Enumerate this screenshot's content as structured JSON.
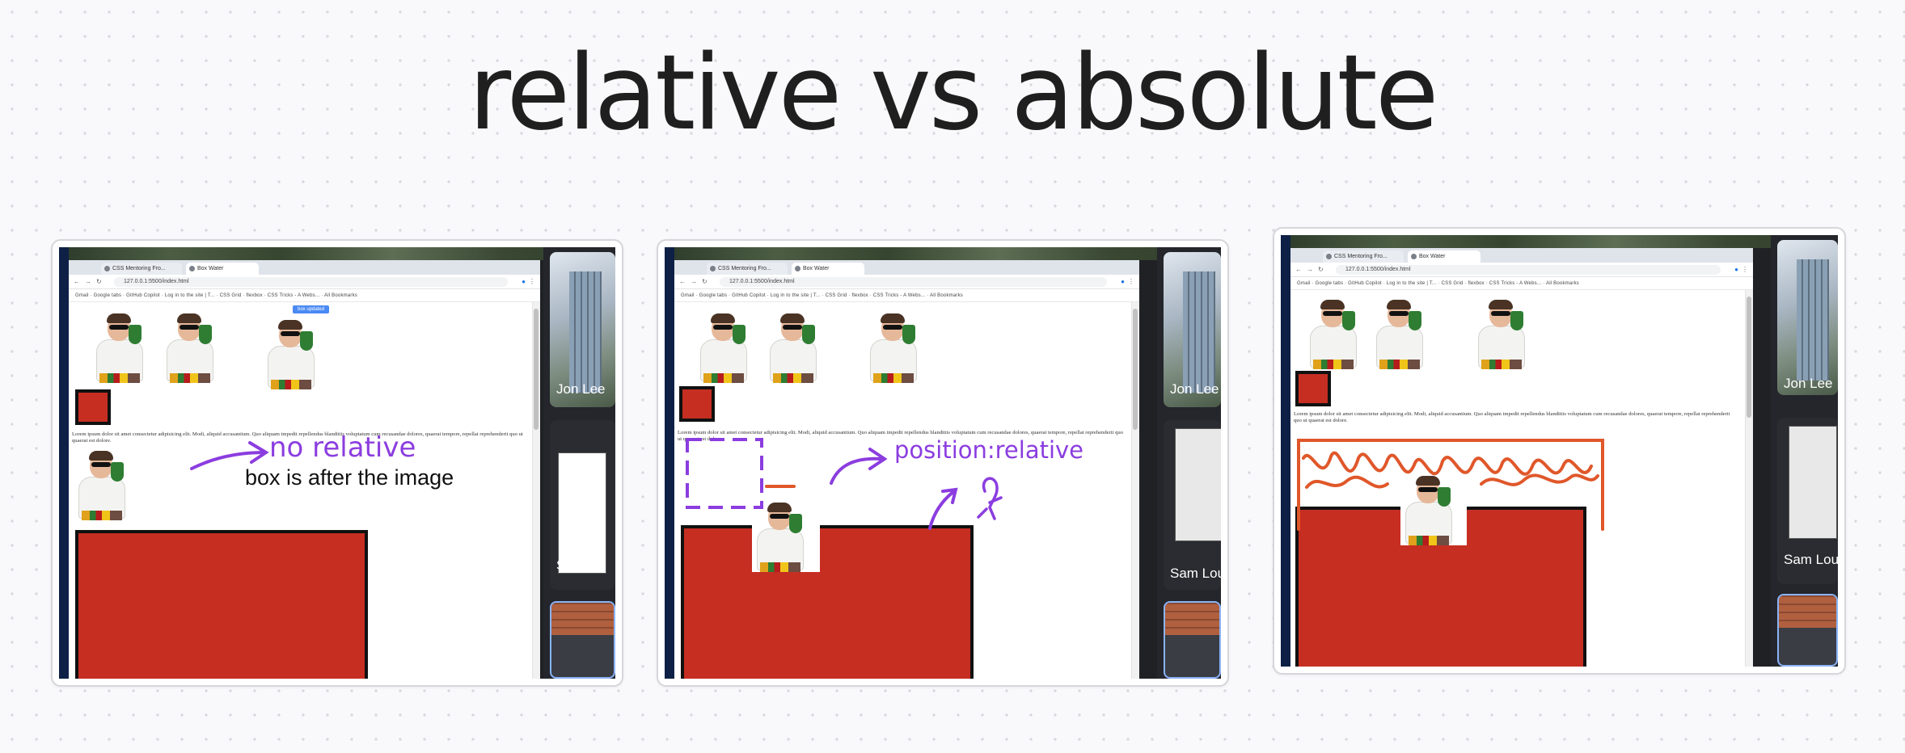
{
  "slide": {
    "title": "relative vs absolute"
  },
  "browser": {
    "tab1_label": "CSS Mentoring Fro...",
    "tab2_label": "Box Water",
    "url": "127.0.0.1:5500/index.html",
    "bookmarks": "Gmail · Google tabs   ·   GitHub Copilot   ·   Log in to the site | T...   ·   CSS Grid · flexbox   ·   CSS Tricks - A Webs...   ·   All Bookmarks",
    "lorem": "Lorem ipsum dolor sit amet consectetur adipisicing elit. Modi, aliquid accusantium. Quo aliquam impedit repellendus blanditiis voluptatum cum recusandae dolores, quaerat tempore, repellat reprehenderit quo ut quaerat est dolore."
  },
  "panels": [
    {
      "annotation": "no relative",
      "label": "box is after the image",
      "button_label": "box updated",
      "participants": [
        "Jon Lee",
        "Sam Le"
      ]
    },
    {
      "annotation": "position:relative",
      "participants": [
        "Jon Lee",
        "Sam Lou"
      ]
    },
    {
      "participants": [
        "Jon Lee",
        "Sam Lou"
      ]
    }
  ],
  "colors": {
    "red_box": "#c62e22",
    "annotation_purple": "#8b3ddf",
    "scribble_orange": "#e0572a"
  },
  "icons": [
    "back-icon",
    "forward-icon",
    "reload-icon",
    "profile-icon",
    "menu-icon"
  ]
}
